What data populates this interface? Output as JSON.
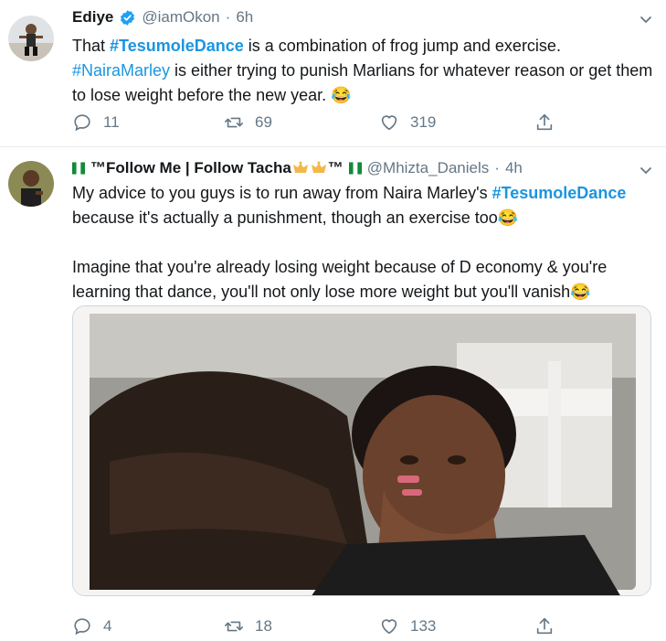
{
  "tweets": [
    {
      "name": "Ediye",
      "handle": "@iamOkon",
      "sep": "·",
      "time": "6h",
      "text_parts": [
        {
          "t": "That ",
          "type": "text"
        },
        {
          "t": "#TesumoleDance",
          "type": "hashtag-bold"
        },
        {
          "t": " is a combination of frog jump and exercise. ",
          "type": "text"
        },
        {
          "t": "#NairaMarley",
          "type": "hashtag"
        },
        {
          "t": " is either trying to punish Marlians for whatever reason or get them to lose weight before the new year. ",
          "type": "text"
        },
        {
          "t": "😂",
          "type": "emoji"
        }
      ],
      "replies": "11",
      "retweets": "69",
      "likes": "319"
    },
    {
      "name_prefix": "™Follow Me | Follow Tacha",
      "name_suffix": "™",
      "handle": "@Mhizta_Daniels",
      "sep": "·",
      "time": "4h",
      "text_lines": [
        "My advice to you guys is to run away from Naira Marley's ",
        "#TesumoleDance",
        " because it's actually a punishment, though an exercise too😂",
        "Imagine that you're already losing weight because of D economy & you're learning that dance, you'll not only lose more weight but you'll vanish😂"
      ],
      "replies": "4",
      "retweets": "18",
      "likes": "133"
    }
  ],
  "colors": {
    "accent": "#1b95e0",
    "muted": "#657786",
    "text": "#14171a"
  }
}
